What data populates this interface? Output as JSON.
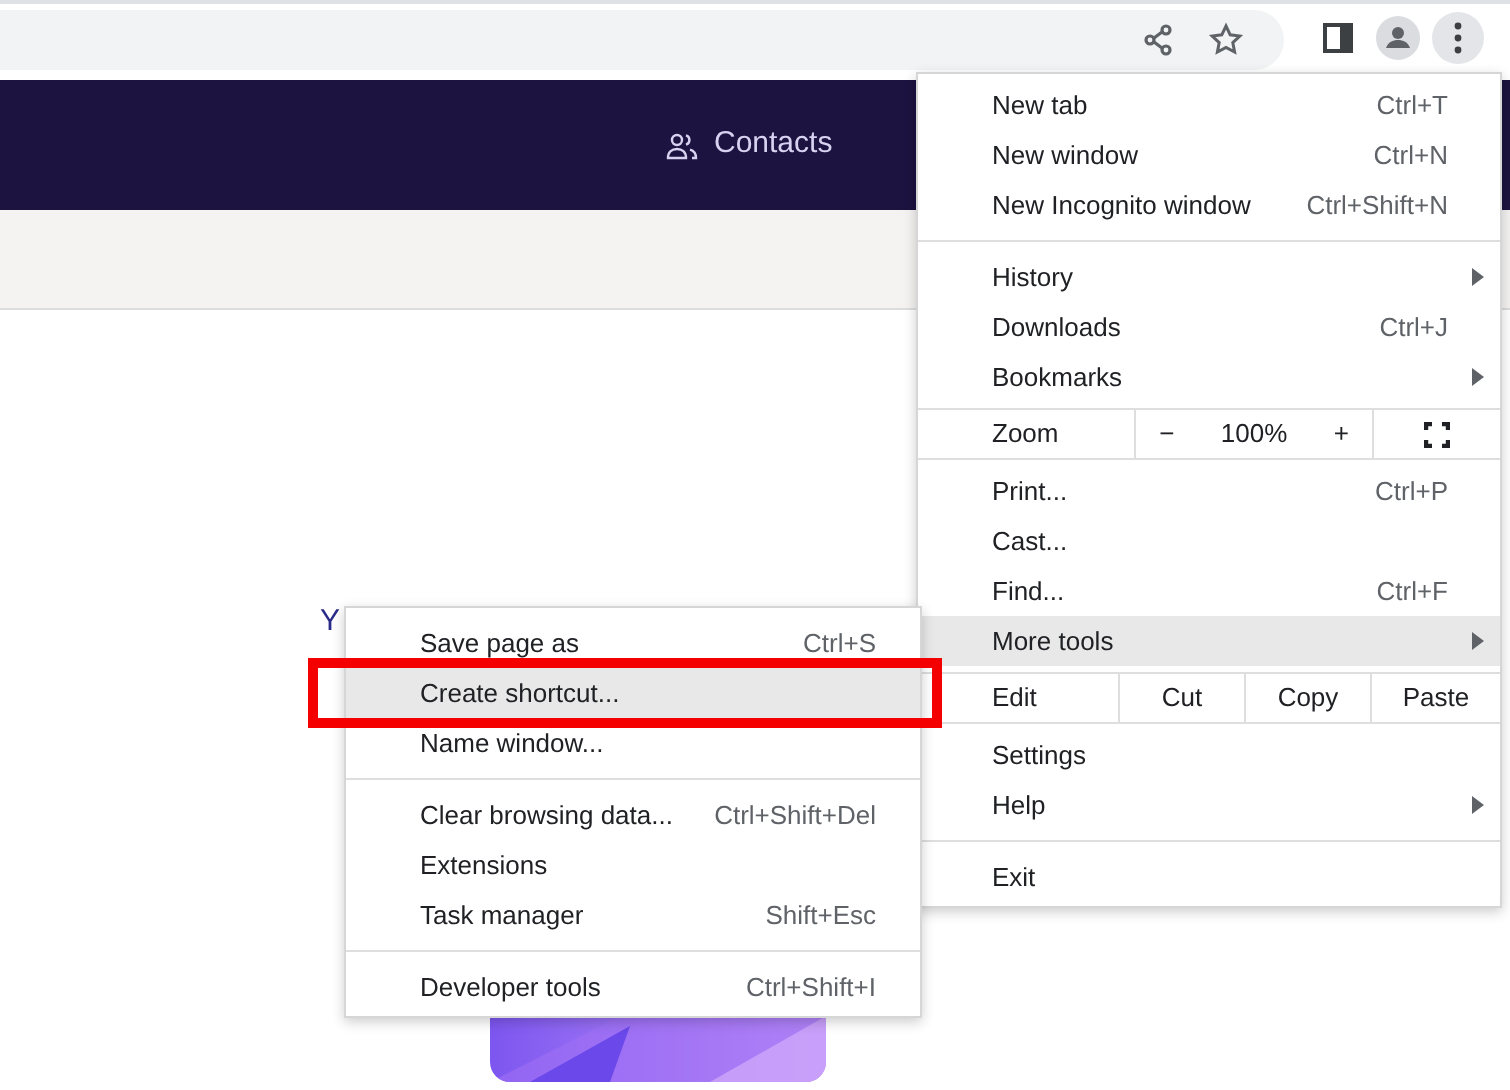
{
  "page": {
    "nav": [
      {
        "label": "Contacts"
      }
    ],
    "partial_text": "Y"
  },
  "menu": {
    "groups": [
      [
        {
          "kind": "item",
          "label": "New tab",
          "shortcut": "Ctrl+T",
          "submenu": false,
          "selected": false
        },
        {
          "kind": "item",
          "label": "New window",
          "shortcut": "Ctrl+N",
          "submenu": false,
          "selected": false
        },
        {
          "kind": "item",
          "label": "New Incognito window",
          "shortcut": "Ctrl+Shift+N",
          "submenu": false,
          "selected": false
        }
      ],
      [
        {
          "kind": "item",
          "label": "History",
          "submenu": true,
          "selected": false
        },
        {
          "kind": "item",
          "label": "Downloads",
          "shortcut": "Ctrl+J",
          "submenu": false,
          "selected": false
        },
        {
          "kind": "item",
          "label": "Bookmarks",
          "submenu": true,
          "selected": false
        }
      ],
      [
        {
          "kind": "zoom",
          "label": "Zoom",
          "minus": "−",
          "value": "100%",
          "plus": "+"
        }
      ],
      [
        {
          "kind": "item",
          "label": "Print...",
          "shortcut": "Ctrl+P",
          "submenu": false,
          "selected": false
        },
        {
          "kind": "item",
          "label": "Cast...",
          "submenu": false,
          "selected": false
        },
        {
          "kind": "item",
          "label": "Find...",
          "shortcut": "Ctrl+F",
          "submenu": false,
          "selected": false
        },
        {
          "kind": "item",
          "label": "More tools",
          "submenu": true,
          "selected": true
        }
      ],
      [
        {
          "kind": "edit",
          "label": "Edit",
          "buttons": [
            "Cut",
            "Copy",
            "Paste"
          ]
        }
      ],
      [
        {
          "kind": "item",
          "label": "Settings",
          "submenu": false,
          "selected": false
        },
        {
          "kind": "item",
          "label": "Help",
          "submenu": true,
          "selected": false
        }
      ],
      [
        {
          "kind": "item",
          "label": "Exit",
          "submenu": false,
          "selected": false
        }
      ]
    ]
  },
  "submenu": {
    "groups": [
      [
        {
          "label": "Save page as",
          "shortcut": "Ctrl+S",
          "selected": false,
          "outlined": false
        },
        {
          "label": "Create shortcut...",
          "selected": true,
          "outlined": true
        },
        {
          "label": "Name window...",
          "selected": false,
          "outlined": false
        }
      ],
      [
        {
          "label": "Clear browsing data...",
          "shortcut": "Ctrl+Shift+Del",
          "selected": false,
          "outlined": false
        },
        {
          "label": "Extensions",
          "selected": false,
          "outlined": false
        },
        {
          "label": "Task manager",
          "shortcut": "Shift+Esc",
          "selected": false,
          "outlined": false
        }
      ],
      [
        {
          "label": "Developer tools",
          "shortcut": "Ctrl+Shift+I",
          "selected": false,
          "outlined": false
        }
      ]
    ]
  }
}
